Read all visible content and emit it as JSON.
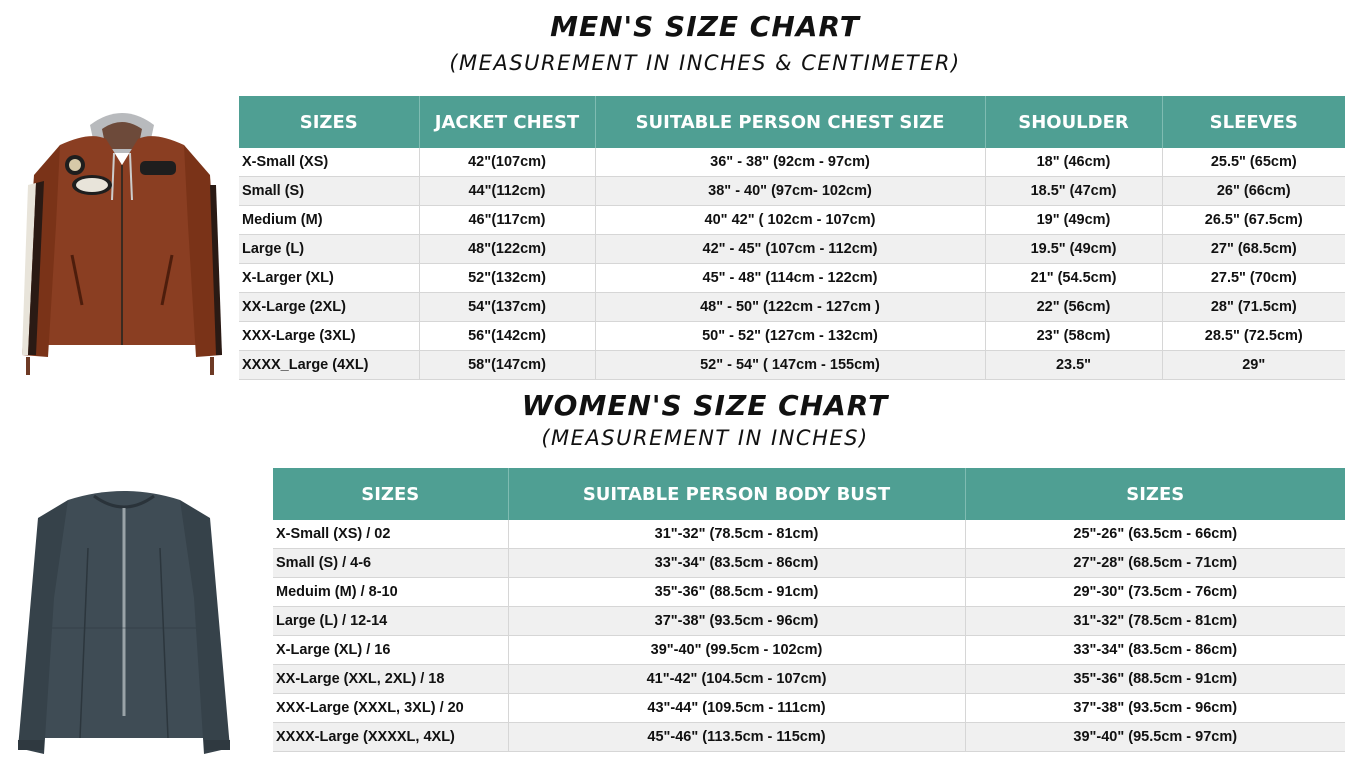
{
  "men": {
    "title": "MEN'S SIZE CHART",
    "subtitle": "(MEASUREMENT IN INCHES & CENTIMETER)",
    "headers": [
      "SIZES",
      "JACKET CHEST",
      "SUITABLE PERSON CHEST SIZE",
      "SHOULDER",
      "SLEEVES"
    ],
    "rows": [
      [
        "X-Small (XS)",
        "42\"(107cm)",
        "36\" - 38\" (92cm - 97cm)",
        "18\" (46cm)",
        "25.5\" (65cm)"
      ],
      [
        "Small (S)",
        "44\"(112cm)",
        "38\" - 40\" (97cm- 102cm)",
        "18.5\" (47cm)",
        "26\" (66cm)"
      ],
      [
        "Medium (M)",
        "46\"(117cm)",
        "40\"  42\" ( 102cm - 107cm)",
        "19\" (49cm)",
        "26.5\" (67.5cm)"
      ],
      [
        "Large (L)",
        "48\"(122cm)",
        "42\" - 45\" (107cm - 112cm)",
        "19.5\" (49cm)",
        "27\" (68.5cm)"
      ],
      [
        "X-Larger (XL)",
        "52\"(132cm)",
        "45\" - 48\" (114cm - 122cm)",
        "21\" (54.5cm)",
        "27.5\" (70cm)"
      ],
      [
        "XX-Large (2XL)",
        "54\"(137cm)",
        "48\" - 50\" (122cm - 127cm )",
        "22\" (56cm)",
        "28\" (71.5cm)"
      ],
      [
        "XXX-Large (3XL)",
        "56\"(142cm)",
        "50\" - 52\" (127cm - 132cm)",
        "23\" (58cm)",
        "28.5\" (72.5cm)"
      ],
      [
        "XXXX_Large (4XL)",
        "58\"(147cm)",
        "52\" - 54\" ( 147cm - 155cm)",
        "23.5\"",
        "29\""
      ]
    ]
  },
  "women": {
    "title": "WOMEN'S SIZE CHART",
    "subtitle": "(MEASUREMENT IN INCHES)",
    "headers": [
      "SIZES",
      "SUITABLE PERSON BODY BUST",
      "SIZES"
    ],
    "rows": [
      [
        "X-Small (XS) / 02",
        "31\"-32\" (78.5cm - 81cm)",
        "25\"-26\" (63.5cm - 66cm)"
      ],
      [
        "Small (S) / 4-6",
        "33\"-34\" (83.5cm - 86cm)",
        "27\"-28\" (68.5cm - 71cm)"
      ],
      [
        "Meduim (M) / 8-10",
        "35\"-36\" (88.5cm - 91cm)",
        "29\"-30\" (73.5cm - 76cm)"
      ],
      [
        "Large (L) / 12-14",
        "37\"-38\" (93.5cm - 96cm)",
        "31\"-32\" (78.5cm - 81cm)"
      ],
      [
        "X-Large  (XL) / 16",
        "39\"-40\" (99.5cm - 102cm)",
        "33\"-34\" (83.5cm - 86cm)"
      ],
      [
        "XX-Large (XXL, 2XL) / 18",
        "41\"-42\" (104.5cm - 107cm)",
        "35\"-36\" (88.5cm - 91cm)"
      ],
      [
        "XXX-Large (XXXL, 3XL) / 20",
        "43\"-44\" (109.5cm - 111cm)",
        "37\"-38\" (93.5cm - 96cm)"
      ],
      [
        "XXXX-Large (XXXXL, 4XL)",
        "45\"-46\" (113.5cm - 115cm)",
        "39\"-40\" (95.5cm - 97cm)"
      ]
    ]
  },
  "colors": {
    "header_bg": "#4f9f93",
    "header_text": "#ffffff",
    "alt_row": "#f0f0f0"
  }
}
